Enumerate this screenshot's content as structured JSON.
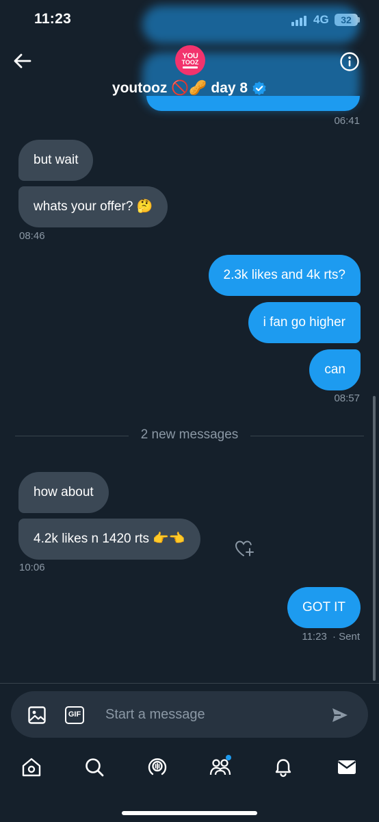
{
  "status_bar": {
    "time": "11:23",
    "network": "4G",
    "battery": "32"
  },
  "header": {
    "display_name": "youtooz 🚫🥜 day 8",
    "avatar_text_line1": "YOU",
    "avatar_text_line2": "TOOZ",
    "verified": true
  },
  "messages": {
    "prev_timestamp": "06:41",
    "group1": [
      {
        "text": "but wait",
        "from": "them"
      },
      {
        "text": "whats your offer? 🤔",
        "from": "them"
      }
    ],
    "group1_timestamp": "08:46",
    "group2": [
      {
        "text": "2.3k likes and 4k rts?",
        "from": "me"
      },
      {
        "text": "i fan go higher",
        "from": "me"
      },
      {
        "text": "can",
        "from": "me"
      }
    ],
    "group2_timestamp": "08:57",
    "new_messages_label": "2 new messages",
    "group3": [
      {
        "text": "how about",
        "from": "them"
      },
      {
        "text": "4.2k likes n 1420 rts 👉👈",
        "from": "them"
      }
    ],
    "group3_timestamp": "10:06",
    "group4": [
      {
        "text": "GOT IT",
        "from": "me"
      }
    ],
    "group4_timestamp": "11:23",
    "group4_status": "· Sent"
  },
  "composer": {
    "placeholder": "Start a message",
    "gif_label": "GIF"
  },
  "colors": {
    "background": "#15202b",
    "accent": "#1d9bf0",
    "received_bubble": "#3b4855",
    "muted_text": "#8b98a5"
  },
  "nav": {
    "icons": [
      "home-icon",
      "search-icon",
      "spaces-icon",
      "communities-icon",
      "notifications-icon",
      "messages-icon"
    ]
  }
}
